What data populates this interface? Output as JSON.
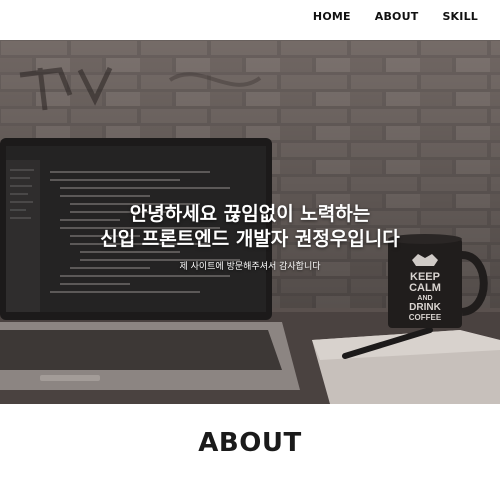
{
  "nav": {
    "items": [
      {
        "label": "HOME"
      },
      {
        "label": "ABOUT"
      },
      {
        "label": "SKILL"
      }
    ]
  },
  "hero": {
    "line1": "안녕하세요 끊임없이 노력하는",
    "line2": "신입 프론트엔드 개발자 권정우입니다",
    "subtitle": "제 사이트에 방문해주셔서 감사합니다",
    "mug_text": [
      "KEEP",
      "CALM",
      "AND",
      "DRINK",
      "COFFEE"
    ]
  },
  "about": {
    "title": "ABOUT"
  },
  "colors": {
    "hero_overlay": "#3a3230",
    "text_light": "#ffffff",
    "text_dark": "#111111"
  }
}
